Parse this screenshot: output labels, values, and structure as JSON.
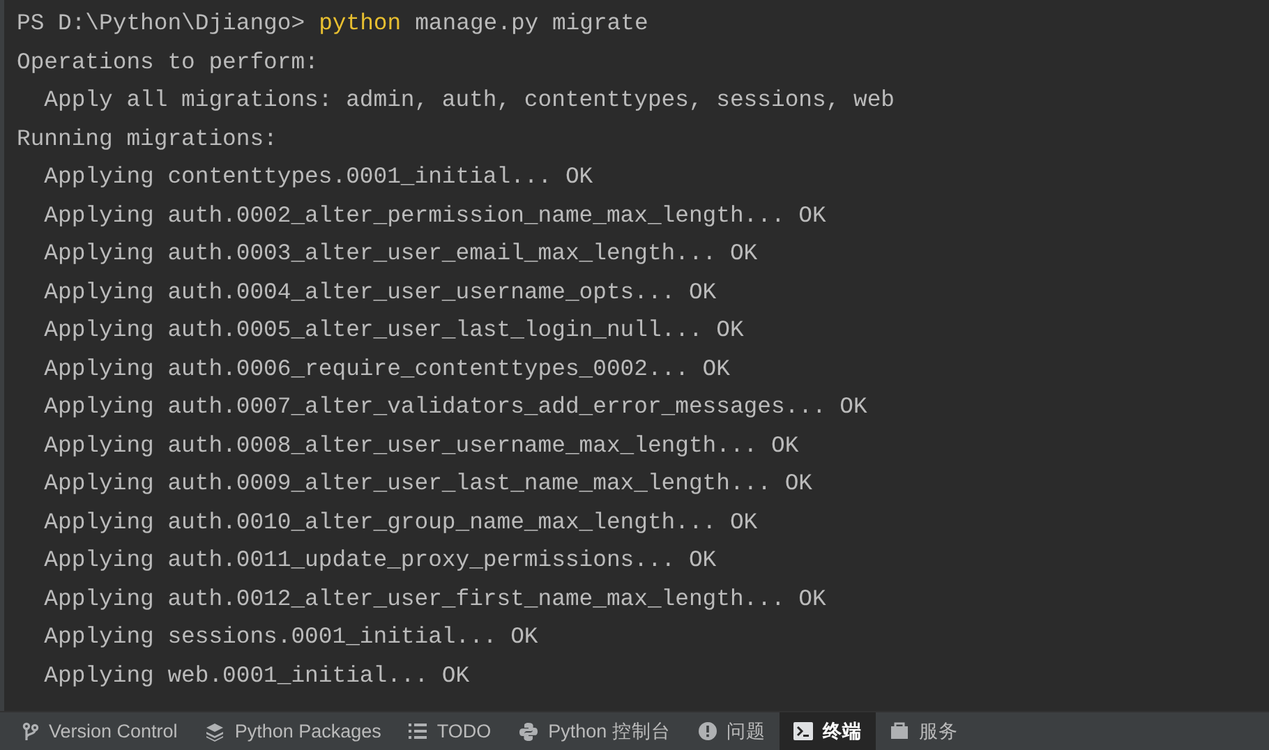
{
  "terminal": {
    "prompt_line": {
      "prompt": "PS D:\\Python\\Djiango>",
      "command": "python",
      "args": "manage.py migrate"
    },
    "output": [
      "Operations to perform:",
      "  Apply all migrations: admin, auth, contenttypes, sessions, web",
      "Running migrations:",
      "  Applying contenttypes.0001_initial... OK",
      "  Applying auth.0002_alter_permission_name_max_length... OK",
      "  Applying auth.0003_alter_user_email_max_length... OK",
      "  Applying auth.0004_alter_user_username_opts... OK",
      "  Applying auth.0005_alter_user_last_login_null... OK",
      "  Applying auth.0006_require_contenttypes_0002... OK",
      "  Applying auth.0007_alter_validators_add_error_messages... OK",
      "  Applying auth.0008_alter_user_username_max_length... OK",
      "  Applying auth.0009_alter_user_last_name_max_length... OK",
      "  Applying auth.0010_alter_group_name_max_length... OK",
      "  Applying auth.0011_update_proxy_permissions... OK",
      "  Applying auth.0012_alter_user_first_name_max_length... OK",
      "  Applying sessions.0001_initial... OK",
      "  Applying web.0001_initial... OK"
    ]
  },
  "tool_tabs": [
    {
      "kind": "vcs",
      "label": "Version Control",
      "selected": false
    },
    {
      "kind": "packages",
      "label": "Python Packages",
      "selected": false
    },
    {
      "kind": "todo",
      "label": "TODO",
      "selected": false
    },
    {
      "kind": "python",
      "label": "Python 控制台",
      "selected": false
    },
    {
      "kind": "problems",
      "label": "问题",
      "selected": false
    },
    {
      "kind": "terminal",
      "label": "终端",
      "selected": true
    },
    {
      "kind": "services",
      "label": "服务",
      "selected": false
    }
  ]
}
